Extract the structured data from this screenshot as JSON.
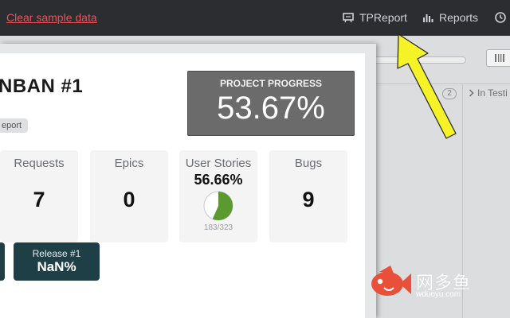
{
  "topbar": {
    "clear_link": "Clear sample data",
    "tpreport_label": "TPReport",
    "reports_label": "Reports",
    "icons": [
      "presentation-icon",
      "bar-chart-icon",
      "clock-icon"
    ]
  },
  "board": {
    "column_count": "2",
    "column_title": "In Testi"
  },
  "popup": {
    "title": "NBAN #1",
    "report_tag": "eport",
    "progress_label": "PROJECT PROGRESS",
    "progress_value": "53.67%",
    "stats": {
      "requests": {
        "label": "Requests",
        "value": "7"
      },
      "epics": {
        "label": "Epics",
        "value": "0"
      },
      "user_stories": {
        "label": "User Stories",
        "percent": "56.66%",
        "count": "183/323",
        "fraction": 0.5666
      },
      "bugs": {
        "label": "Bugs",
        "value": "9"
      }
    },
    "release": {
      "name": "Release #1",
      "value": "NaN%"
    }
  },
  "watermark": {
    "text": "网多鱼",
    "domain": "wduoyu.com"
  },
  "colors": {
    "topbar": "#2b2d31",
    "link": "#e8545a",
    "progress_box": "#6b6b6b",
    "pie_fill": "#5a9a2e",
    "release_card": "#1f3f46",
    "arrow": "#f5f227"
  }
}
